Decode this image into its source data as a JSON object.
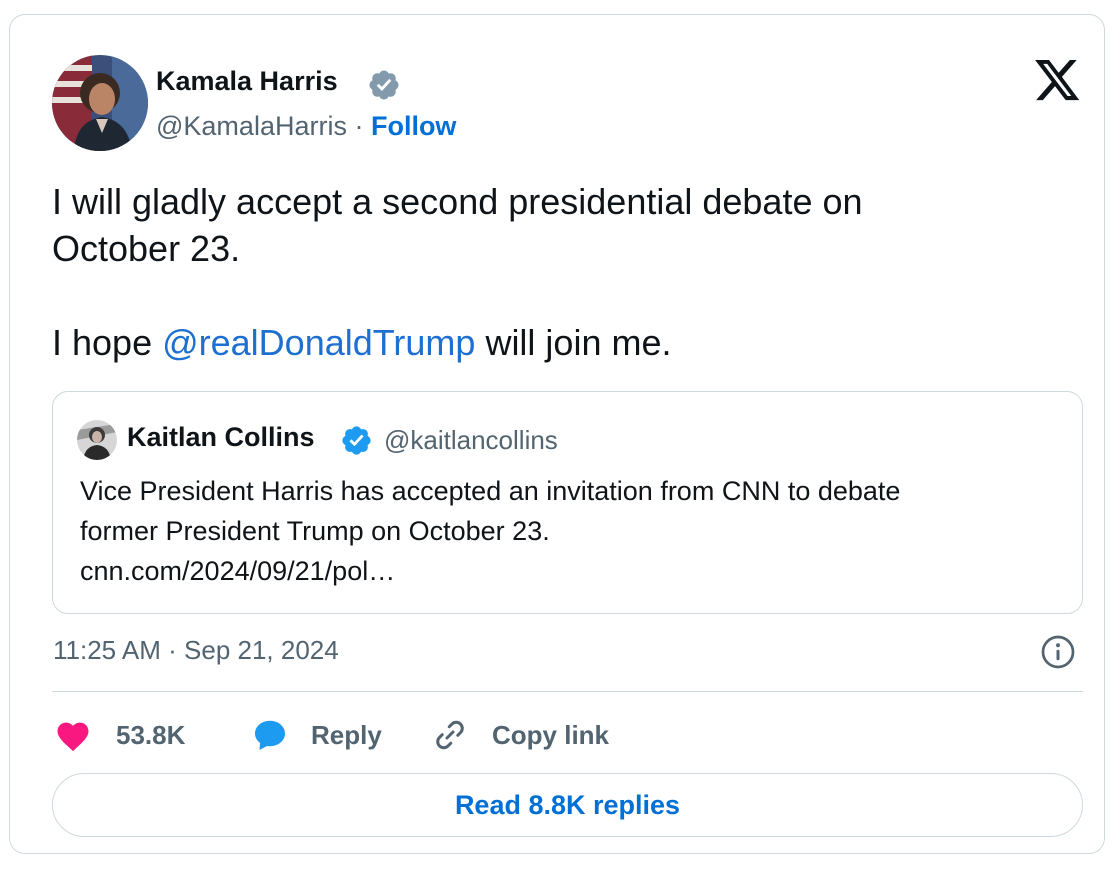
{
  "tweet": {
    "author": {
      "name": "Kamala Harris",
      "handle": "@KamalaHarris",
      "separator": " · ",
      "follow_label": "Follow",
      "verified_badge": "gray-verified-icon"
    },
    "text_lines": [
      "I will gladly accept a second presidential debate on",
      "October 23."
    ],
    "text_second": {
      "before": "I hope ",
      "mention": "@realDonaldTrump",
      "after": " will join me."
    },
    "timestamp": "11:25 AM · Sep 21, 2024"
  },
  "quoted_tweet": {
    "name": "Kaitlan Collins",
    "handle": "@kaitlancollins",
    "verified_badge": "blue-verified-icon",
    "text_lines": [
      "Vice President Harris has accepted an invitation from CNN to debate",
      "former President Trump on October 23."
    ],
    "link": "cnn.com/2024/09/21/pol…"
  },
  "actions": {
    "like_count": "53.8K",
    "reply_label": "Reply",
    "copy_label": "Copy link"
  },
  "read_replies_label": "Read 8.8K replies",
  "colors": {
    "link_blue": "#006fd6",
    "mention_blue": "#1d6fd0",
    "verified_blue": "#1d9bf0",
    "verified_gray": "#829aab",
    "heart_pink": "#f91880",
    "text_secondary": "#536471",
    "border": "#cfd9de"
  }
}
